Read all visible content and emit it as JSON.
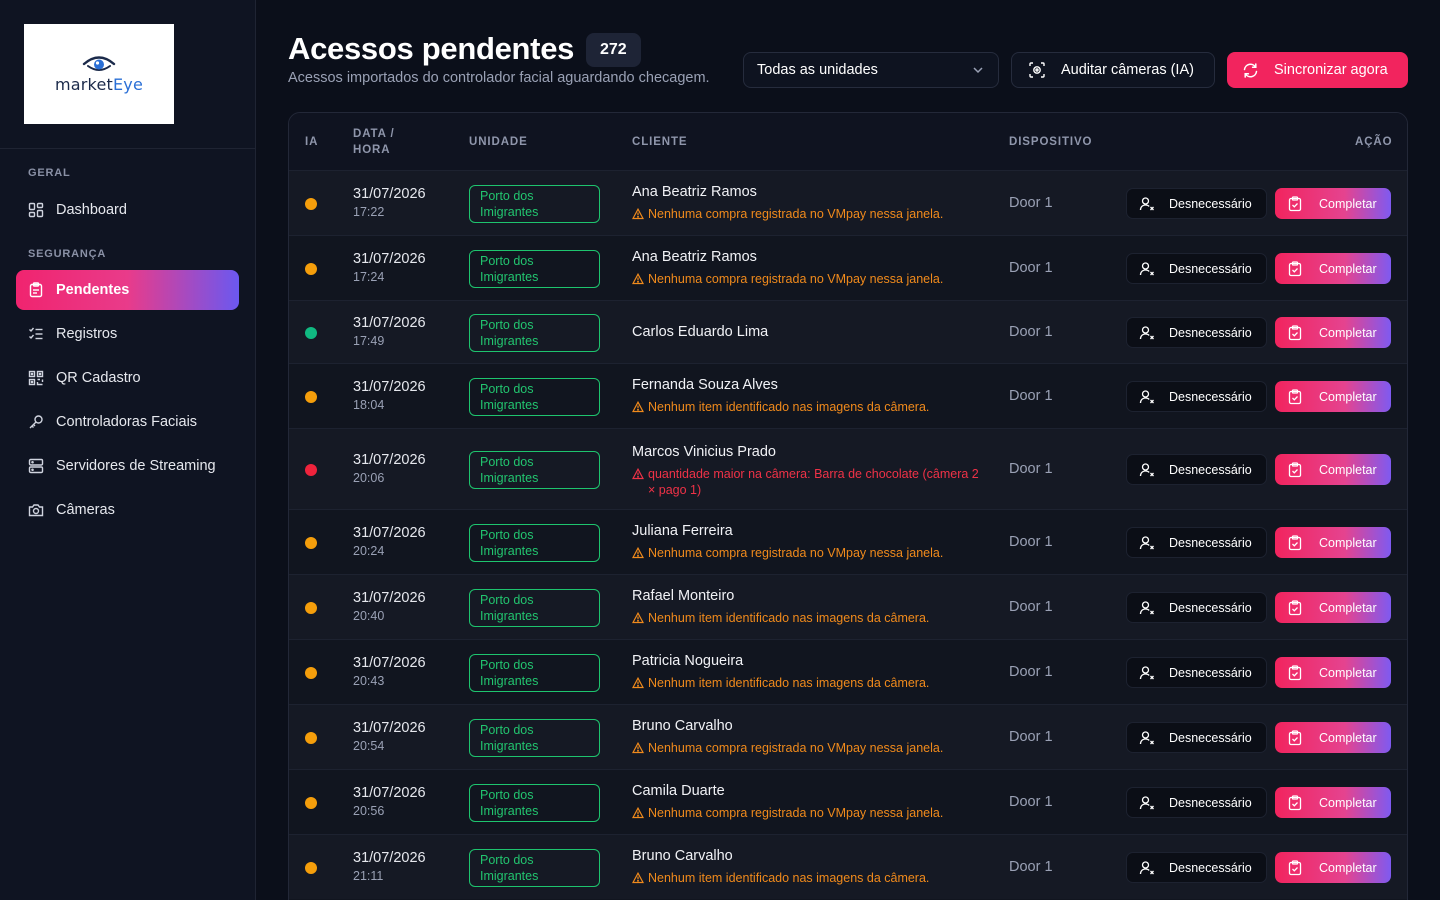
{
  "brand": {
    "logo_text_1": "market",
    "logo_text_2": "Eye"
  },
  "sidebar": {
    "sections": [
      {
        "label": "GERAL"
      },
      {
        "label": "SEGURANÇA"
      }
    ],
    "items": [
      {
        "label": "Dashboard",
        "icon": "dashboard-icon"
      },
      {
        "label": "Pendentes",
        "icon": "clipboard-icon",
        "active": true
      },
      {
        "label": "Registros",
        "icon": "checklist-icon"
      },
      {
        "label": "QR Cadastro",
        "icon": "qr-code-icon"
      },
      {
        "label": "Controladoras Faciais",
        "icon": "key-icon"
      },
      {
        "label": "Servidores de Streaming",
        "icon": "server-icon"
      },
      {
        "label": "Câmeras",
        "icon": "camera-icon"
      }
    ]
  },
  "header": {
    "title": "Acessos pendentes",
    "count": "272",
    "subtitle": "Acessos importados do controlador facial aguardando checagem.",
    "unit_select": "Todas as unidades",
    "audit_button": "Auditar câmeras (IA)",
    "sync_button": "Sincronizar agora"
  },
  "colors": {
    "accent": "#f2245e",
    "ia_orange": "#f59e0b",
    "ia_green": "#10b981",
    "ia_red": "#ef233c",
    "unit_green": "#22c56f"
  },
  "table": {
    "headers": {
      "ia": "IA",
      "datetime_1": "DATA /",
      "datetime_2": "HORA",
      "unit": "UNIDADE",
      "client": "CLIENTE",
      "device": "DISPOSITIVO",
      "action": "AÇÃO"
    },
    "action_unneeded": "Desnecessário",
    "action_complete": "Completar",
    "rows": [
      {
        "ia": "orange",
        "date": "31/07/2026",
        "time": "17:22",
        "unit_1": "Porto dos",
        "unit_2": "Imigrantes",
        "client": "Ana Beatriz Ramos",
        "warning": "Nenhuma compra registrada no VMpay nessa janela.",
        "warning_level": "orange",
        "device": "Door 1"
      },
      {
        "ia": "orange",
        "date": "31/07/2026",
        "time": "17:24",
        "unit_1": "Porto dos",
        "unit_2": "Imigrantes",
        "client": "Ana Beatriz Ramos",
        "warning": "Nenhuma compra registrada no VMpay nessa janela.",
        "warning_level": "orange",
        "device": "Door 1"
      },
      {
        "ia": "green",
        "date": "31/07/2026",
        "time": "17:49",
        "unit_1": "Porto dos",
        "unit_2": "Imigrantes",
        "client": "Carlos Eduardo Lima",
        "warning": "",
        "warning_level": "none",
        "device": "Door 1"
      },
      {
        "ia": "orange",
        "date": "31/07/2026",
        "time": "18:04",
        "unit_1": "Porto dos",
        "unit_2": "Imigrantes",
        "client": "Fernanda Souza Alves",
        "warning": "Nenhum item identificado nas imagens da câmera.",
        "warning_level": "orange",
        "device": "Door 1"
      },
      {
        "ia": "red",
        "date": "31/07/2026",
        "time": "20:06",
        "unit_1": "Porto dos",
        "unit_2": "Imigrantes",
        "client": "Marcos Vinicius Prado",
        "warning": "quantidade maior na câmera: Barra de chocolate (câmera 2 × pago 1)",
        "warning_level": "red",
        "device": "Door 1"
      },
      {
        "ia": "orange",
        "date": "31/07/2026",
        "time": "20:24",
        "unit_1": "Porto dos",
        "unit_2": "Imigrantes",
        "client": "Juliana Ferreira",
        "warning": "Nenhuma compra registrada no VMpay nessa janela.",
        "warning_level": "orange",
        "device": "Door 1"
      },
      {
        "ia": "orange",
        "date": "31/07/2026",
        "time": "20:40",
        "unit_1": "Porto dos",
        "unit_2": "Imigrantes",
        "client": "Rafael Monteiro",
        "warning": "Nenhum item identificado nas imagens da câmera.",
        "warning_level": "orange",
        "device": "Door 1"
      },
      {
        "ia": "orange",
        "date": "31/07/2026",
        "time": "20:43",
        "unit_1": "Porto dos",
        "unit_2": "Imigrantes",
        "client": "Patricia Nogueira",
        "warning": "Nenhum item identificado nas imagens da câmera.",
        "warning_level": "orange",
        "device": "Door 1"
      },
      {
        "ia": "orange",
        "date": "31/07/2026",
        "time": "20:54",
        "unit_1": "Porto dos",
        "unit_2": "Imigrantes",
        "client": "Bruno Carvalho",
        "warning": "Nenhuma compra registrada no VMpay nessa janela.",
        "warning_level": "orange",
        "device": "Door 1"
      },
      {
        "ia": "orange",
        "date": "31/07/2026",
        "time": "20:56",
        "unit_1": "Porto dos",
        "unit_2": "Imigrantes",
        "client": "Camila Duarte",
        "warning": "Nenhuma compra registrada no VMpay nessa janela.",
        "warning_level": "orange",
        "device": "Door 1"
      },
      {
        "ia": "orange",
        "date": "31/07/2026",
        "time": "21:11",
        "unit_1": "Porto dos",
        "unit_2": "Imigrantes",
        "client": "Bruno Carvalho",
        "warning": "Nenhum item identificado nas imagens da câmera.",
        "warning_level": "orange",
        "device": "Door 1"
      }
    ]
  }
}
